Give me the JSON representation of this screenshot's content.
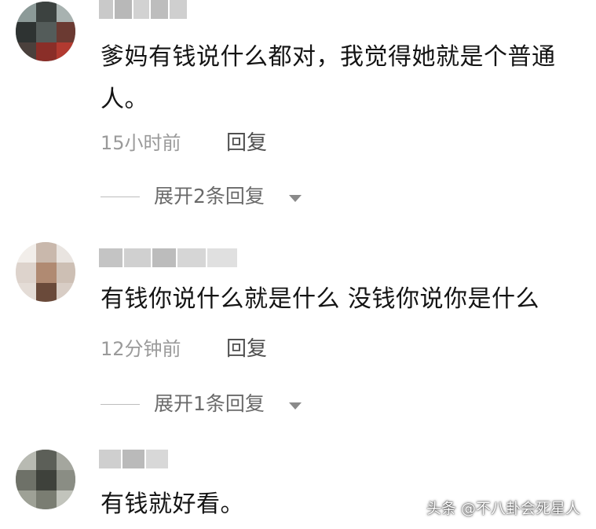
{
  "comments": [
    {
      "text": "爹妈有钱说什么都对，我觉得她就是个普通人。",
      "time": "15小时前",
      "reply_label": "回复",
      "expand_label": "展开2条回复"
    },
    {
      "text": "有钱你说什么就是什么 没钱你说你是什么",
      "time": "12分钟前",
      "reply_label": "回复",
      "expand_label": "展开1条回复"
    },
    {
      "text": "有钱就好看。"
    }
  ],
  "watermark": "头条 @不八卦会死星人",
  "colors": {
    "text": "#141414",
    "time": "#9a9a9a",
    "reply": "#505050",
    "expand": "#6a6a6a"
  }
}
